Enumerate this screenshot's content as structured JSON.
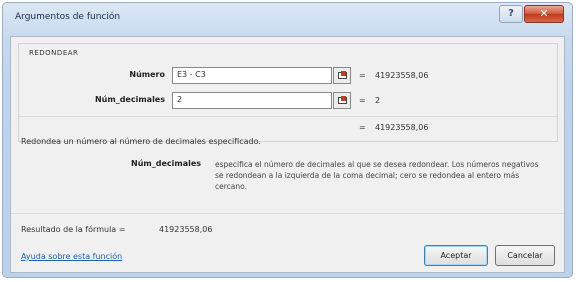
{
  "window": {
    "title": "Argumentos de función"
  },
  "titlebar": {
    "help_glyph": "?",
    "close_glyph": "✕"
  },
  "function": {
    "name": "REDONDEAR"
  },
  "arguments": [
    {
      "label": "Número",
      "input": "E3 - C3",
      "value": "41923558,06"
    },
    {
      "label": "Núm_decimales",
      "input": "2",
      "value": "2"
    }
  ],
  "equals": "=",
  "formula_preview": "41923558,06",
  "description": "Redondea un número al número de decimales especificado.",
  "argument_help": {
    "name": "Núm_decimales",
    "text": "especifica el número de decimales al que se desea redondear. Los números negativos se redondean a la izquierda de la coma decimal; cero se redondea al entero más cercano."
  },
  "result": {
    "label": "Resultado de la fórmula =",
    "value": "41923558,06"
  },
  "help_link": "Ayuda sobre esta función",
  "buttons": {
    "ok": "Aceptar",
    "cancel": "Cancelar"
  },
  "colors": {
    "titlebar": "#bcd1ea",
    "close_button": "#c0391c",
    "link": "#2060b0"
  }
}
